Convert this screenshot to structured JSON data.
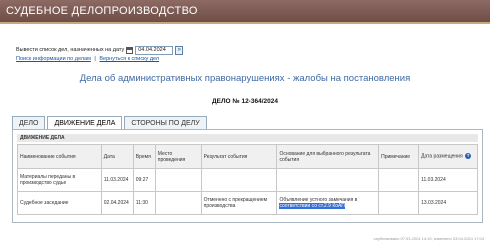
{
  "header": {
    "title": "СУДЕБНОЕ ДЕЛОПРОИЗВОДСТВО"
  },
  "date_filter": {
    "label": "Вывести список дел, назначенных на дату",
    "value": "04.04.2024",
    "go_symbol": "»"
  },
  "links": {
    "search_info": "Поиск информации по делам",
    "back_to_list": "Вернуться к списку дел",
    "separator": "|"
  },
  "section_title": "Дела об административных правонарушениях - жалобы на постановления",
  "case_number": "ДЕЛО № 12-364/2024",
  "tabs": [
    "ДЕЛО",
    "ДВИЖЕНИЕ ДЕЛА",
    "СТОРОНЫ ПО ДЕЛУ"
  ],
  "movement": {
    "caption": "ДВИЖЕНИЕ ДЕЛА",
    "headers": {
      "event_name": "Наименование события",
      "date": "Дата",
      "time": "Время",
      "place": "Место проведения",
      "result": "Результат события",
      "basis": "Основание для выбранного результата события",
      "note": "Примечание",
      "posted_date": "Дата размещения"
    },
    "help_symbol": "?",
    "rows": [
      {
        "event_name": "Материалы переданы в производство судье",
        "date": "11.03.2024",
        "time": "09:27",
        "place": "",
        "result": "",
        "basis_plain": "",
        "basis_highlight": "",
        "note": "",
        "posted_date": "11.03.2024"
      },
      {
        "event_name": "Судебное заседание",
        "date": "02.04.2024",
        "time": "11:30",
        "place": "",
        "result": "Отменено с прекращением производства",
        "basis_plain": "Объявление устного замечания в ",
        "basis_highlight": "соответствии со ст.2.9 КоАП",
        "note": "",
        "posted_date": "13.03.2024"
      }
    ]
  },
  "footer_note": "опубликовано 07.03.2024 14:15, изменено 03.04.2024 17:04"
}
